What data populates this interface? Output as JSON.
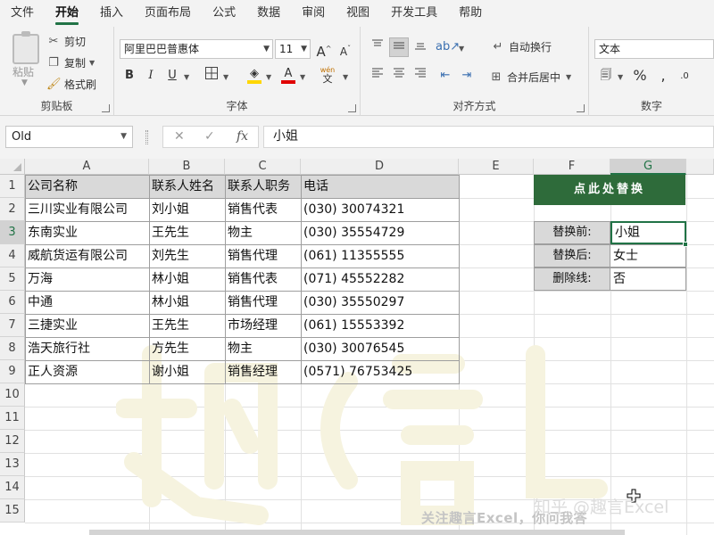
{
  "menu": {
    "tabs": [
      {
        "label": "文件"
      },
      {
        "label": "开始"
      },
      {
        "label": "插入"
      },
      {
        "label": "页面布局"
      },
      {
        "label": "公式"
      },
      {
        "label": "数据"
      },
      {
        "label": "审阅"
      },
      {
        "label": "视图"
      },
      {
        "label": "开发工具"
      },
      {
        "label": "帮助"
      }
    ],
    "active_index": 1
  },
  "ribbon": {
    "clipboard": {
      "paste_label": "粘贴",
      "cut_label": "剪切",
      "copy_label": "复制",
      "format_painter_label": "格式刷",
      "group_label": "剪贴板"
    },
    "font": {
      "font_name": "阿里巴巴普惠体",
      "font_size": "11",
      "increase_size_glyph": "A",
      "decrease_size_glyph": "A",
      "bold_glyph": "B",
      "italic_glyph": "I",
      "underline_glyph": "U",
      "font_color_glyph": "A",
      "pinyin_glyph": "wén",
      "pinyin_char": "文",
      "group_label": "字体",
      "font_color": "#e00000",
      "fill_color": "#ffd700"
    },
    "alignment": {
      "wrap_text_label": "自动换行",
      "merge_center_label": "合并后居中",
      "group_label": "对齐方式"
    },
    "number": {
      "format": "文本",
      "percent_glyph": "%",
      "group_label": "数字"
    }
  },
  "formula_bar": {
    "name_box": "Old",
    "fx_label": "fx",
    "cancel_glyph": "✕",
    "enter_glyph": "✓",
    "content": "小姐"
  },
  "sheet": {
    "columns": [
      "A",
      "B",
      "C",
      "D",
      "E",
      "F",
      "G"
    ],
    "selected_column": "G",
    "rows": [
      "1",
      "2",
      "3",
      "4",
      "5",
      "6",
      "7",
      "8",
      "9",
      "10",
      "11",
      "12",
      "13",
      "14",
      "15"
    ],
    "selected_row": "3",
    "table": {
      "headers": [
        "公司名称",
        "联系人姓名",
        "联系人职务",
        "电话"
      ],
      "rows": [
        [
          "三川实业有限公司",
          "刘小姐",
          "销售代表",
          "(030) 30074321"
        ],
        [
          "东南实业",
          "王先生",
          "物主",
          "(030) 35554729"
        ],
        [
          "威航货运有限公司",
          "刘先生",
          "销售代理",
          "(061) 11355555"
        ],
        [
          "万海",
          "林小姐",
          "销售代表",
          "(071) 45552282"
        ],
        [
          "中通",
          "林小姐",
          "销售代理",
          "(030) 35550297"
        ],
        [
          "三捷实业",
          "王先生",
          "市场经理",
          "(061) 15553392"
        ],
        [
          "浩天旅行社",
          "方先生",
          "物主",
          "(030) 30076545"
        ],
        [
          "正人资源",
          "谢小姐",
          "销售经理",
          "(0571) 76753425"
        ]
      ]
    },
    "replace_button_label": "点此处替换",
    "options": [
      {
        "label": "替换前:",
        "value": "小姐"
      },
      {
        "label": "替换后:",
        "value": "女士"
      },
      {
        "label": "删除线:",
        "value": "否"
      }
    ]
  },
  "watermarks": {
    "follow_text": "关注趣言Excel，你问我答",
    "zhihu_text": "知乎 @趣言Excel"
  },
  "colors": {
    "accent": "#217346",
    "button_bg": "#2e6b3a",
    "header_fill": "#d9d9d9"
  }
}
